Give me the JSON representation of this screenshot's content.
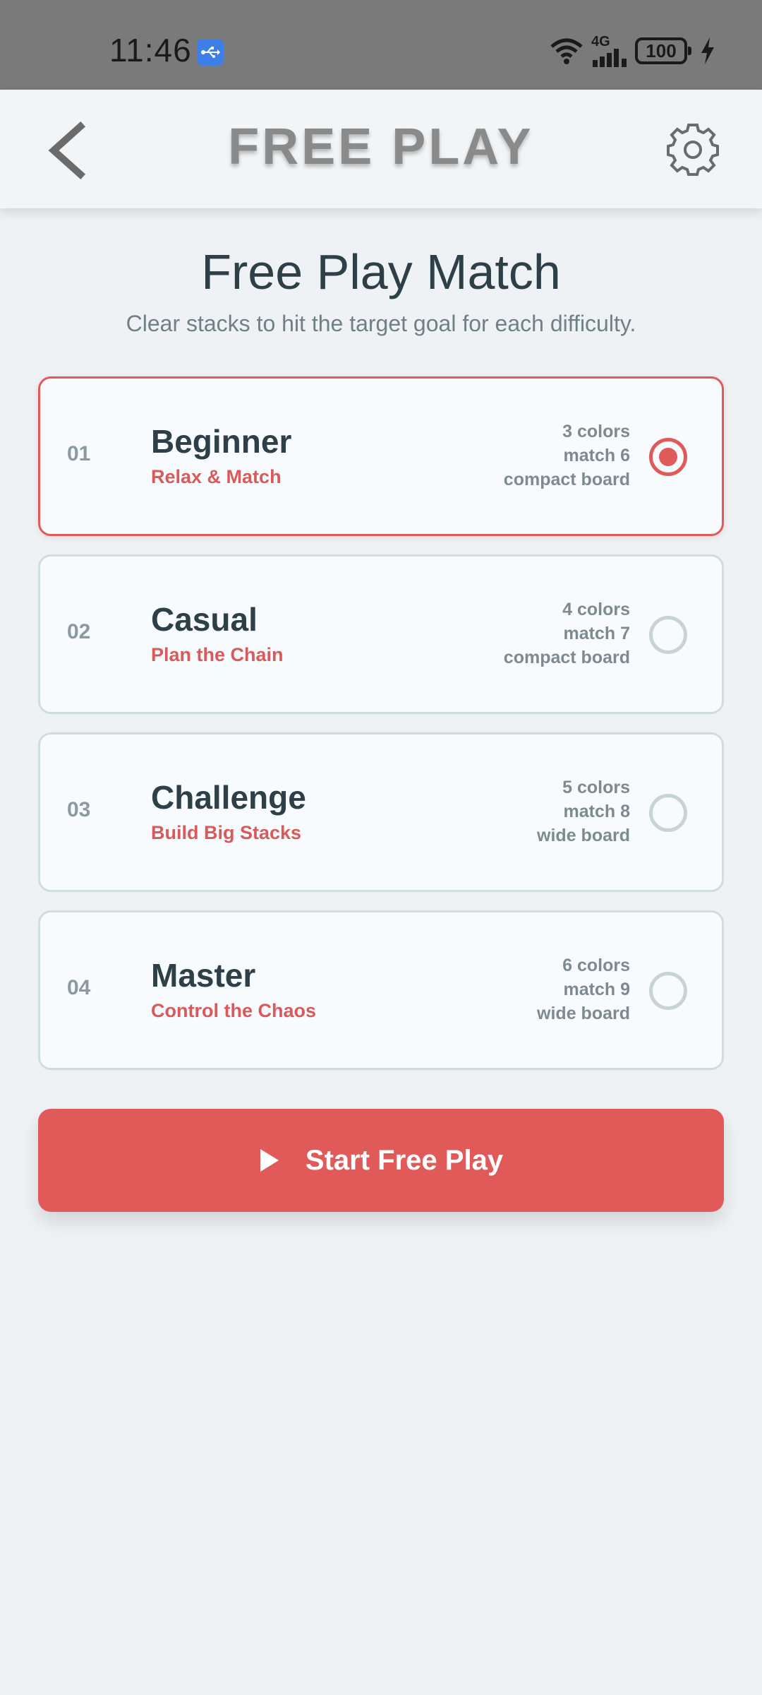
{
  "status_bar": {
    "time": "11:46",
    "network": "4G",
    "battery": "100",
    "icons": [
      "usb-icon",
      "wifi-icon",
      "signal-icon",
      "battery-icon",
      "charging-icon"
    ]
  },
  "app_bar": {
    "title": "FREE PLAY",
    "back_icon": "chevron-left-icon",
    "settings_icon": "gear-icon"
  },
  "header": {
    "title": "Free Play Match",
    "subtitle": "Clear stacks to hit the target goal for each difficulty."
  },
  "levels": [
    {
      "number": "01",
      "name": "Beginner",
      "tagline": "Relax & Match",
      "specs": [
        "3 colors",
        "match 6",
        "compact board"
      ],
      "selected": true
    },
    {
      "number": "02",
      "name": "Casual",
      "tagline": "Plan the Chain",
      "specs": [
        "4 colors",
        "match 7",
        "compact board"
      ],
      "selected": false
    },
    {
      "number": "03",
      "name": "Challenge",
      "tagline": "Build Big Stacks",
      "specs": [
        "5 colors",
        "match 8",
        "wide board"
      ],
      "selected": false
    },
    {
      "number": "04",
      "name": "Master",
      "tagline": "Control the Chaos",
      "specs": [
        "6 colors",
        "match 9",
        "wide board"
      ],
      "selected": false
    }
  ],
  "start_button": {
    "label": "Start Free Play",
    "icon": "play-icon"
  },
  "colors": {
    "accent": "#e15a5a",
    "text_dark": "#2e4047",
    "text_muted": "#7d8b90",
    "background": "#eef2f5"
  }
}
